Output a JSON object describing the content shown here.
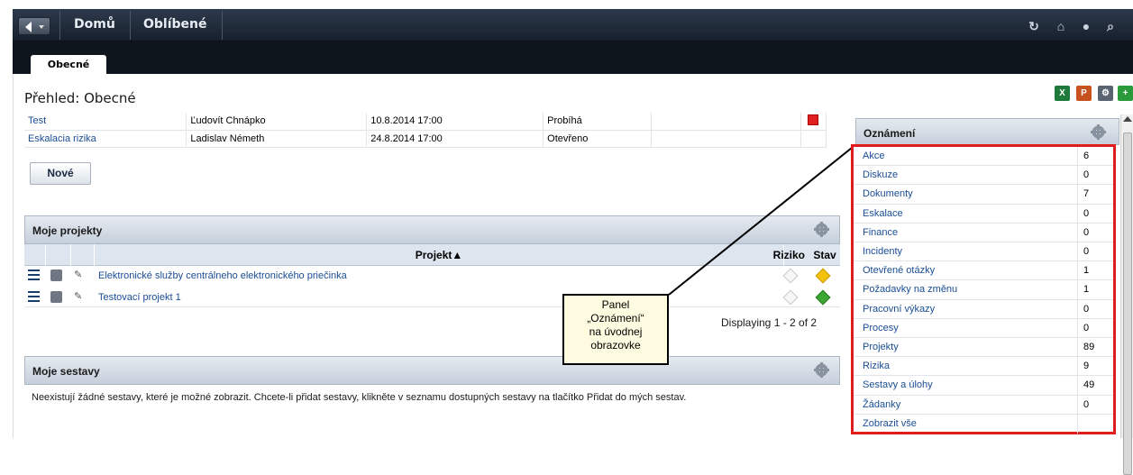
{
  "nav": {
    "home": "Domů",
    "favorites": "Oblíbené",
    "icons": [
      "refresh-icon",
      "home-icon",
      "help-icon",
      "search-icon"
    ]
  },
  "tabs": [
    {
      "label": "Obecné"
    }
  ],
  "page_title": "Přehled: Obecné",
  "toolbar_icons": [
    "excel-icon",
    "powerpoint-icon",
    "settings-icon",
    "add-icon"
  ],
  "issues": [
    {
      "name": "Test",
      "owner": "Ľudovít Chnápko",
      "date": "10.8.2014 17:00",
      "status": "Probíhá",
      "flag": "red"
    },
    {
      "name": "Eskalacia rizika",
      "owner": "Ladislav Németh",
      "date": "24.8.2014 17:00",
      "status": "Otevřeno",
      "flag": ""
    }
  ],
  "new_button": "Nové",
  "projects": {
    "title": "Moje projekty",
    "col_project": "Projekt▲",
    "col_risk": "Riziko",
    "col_state": "Stav",
    "rows": [
      {
        "name": "Elektronické služby centrálneho elektronického priečinka",
        "state_color": "#f4c20d"
      },
      {
        "name": "Testovací projekt 1",
        "state_color": "#3aa832"
      }
    ],
    "displaying": "Displaying 1 - 2 of 2"
  },
  "callout": {
    "lines": [
      "Panel",
      "„Oznámení“",
      "na úvodnej",
      "obrazovke"
    ]
  },
  "reports": {
    "title": "Moje sestavy",
    "empty_text": "Neexistují žádné sestavy, které je možné zobrazit. Chcete-li přidat sestavy, klikněte v seznamu dostupných sestavy na tlačítko Přidat do mých sestav."
  },
  "announcements": {
    "title": "Oznámení",
    "items": [
      {
        "label": "Akce",
        "value": "6"
      },
      {
        "label": "Diskuze",
        "value": "0"
      },
      {
        "label": "Dokumenty",
        "value": "7"
      },
      {
        "label": "Eskalace",
        "value": "0"
      },
      {
        "label": "Finance",
        "value": "0"
      },
      {
        "label": "Incidenty",
        "value": "0"
      },
      {
        "label": "Otevřené otázky",
        "value": "1"
      },
      {
        "label": "Požadavky na změnu",
        "value": "1"
      },
      {
        "label": "Pracovní výkazy",
        "value": "0"
      },
      {
        "label": "Procesy",
        "value": "0"
      },
      {
        "label": "Projekty",
        "value": "89"
      },
      {
        "label": "Rizika",
        "value": "9"
      },
      {
        "label": "Sestavy a úlohy",
        "value": "49"
      },
      {
        "label": "Žádanky",
        "value": "0"
      },
      {
        "label": "Zobrazit vše",
        "value": ""
      }
    ]
  },
  "colors": {
    "highlight": "#e01c1c",
    "nav_bg": "#1f2a38",
    "link": "#1a4d93"
  }
}
